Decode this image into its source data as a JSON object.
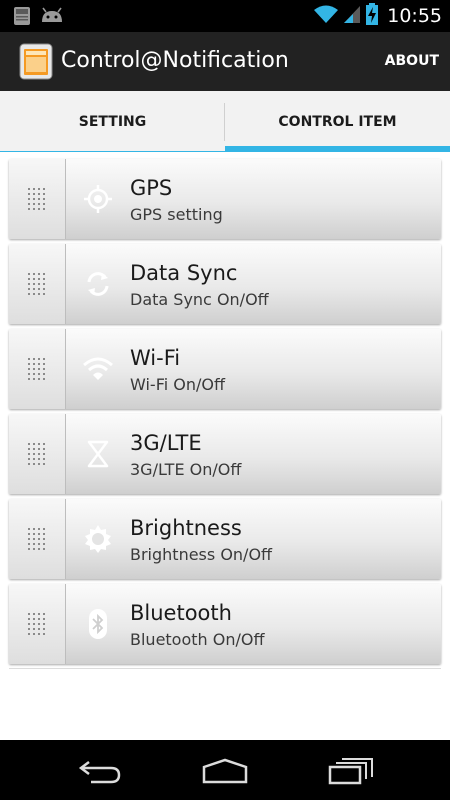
{
  "status_bar": {
    "time": "10:55",
    "icons": [
      "sd-card-icon",
      "android-icon",
      "wifi-icon",
      "signal-icon",
      "battery-charging-icon"
    ]
  },
  "action_bar": {
    "title": "Control@Notification",
    "about_label": "ABOUT"
  },
  "tabs": [
    {
      "label": "SETTING",
      "active": false
    },
    {
      "label": "CONTROL ITEM",
      "active": true
    }
  ],
  "items": [
    {
      "title": "GPS",
      "subtitle": "GPS setting",
      "icon": "gps-icon"
    },
    {
      "title": "Data Sync",
      "subtitle": "Data Sync On/Off",
      "icon": "sync-icon"
    },
    {
      "title": "Wi-Fi",
      "subtitle": "Wi-Fi On/Off",
      "icon": "wifi-icon"
    },
    {
      "title": "3G/LTE",
      "subtitle": "3G/LTE On/Off",
      "icon": "hourglass-icon"
    },
    {
      "title": "Brightness",
      "subtitle": "Brightness On/Off",
      "icon": "brightness-icon"
    },
    {
      "title": "Bluetooth",
      "subtitle": "Bluetooth On/Off",
      "icon": "bluetooth-icon"
    }
  ],
  "nav_bar": {
    "buttons": [
      "back-icon",
      "home-icon",
      "recents-icon"
    ]
  },
  "colors": {
    "accent": "#33b5e5",
    "action_bar": "#222222",
    "tab_bar": "#f2f2f2"
  }
}
